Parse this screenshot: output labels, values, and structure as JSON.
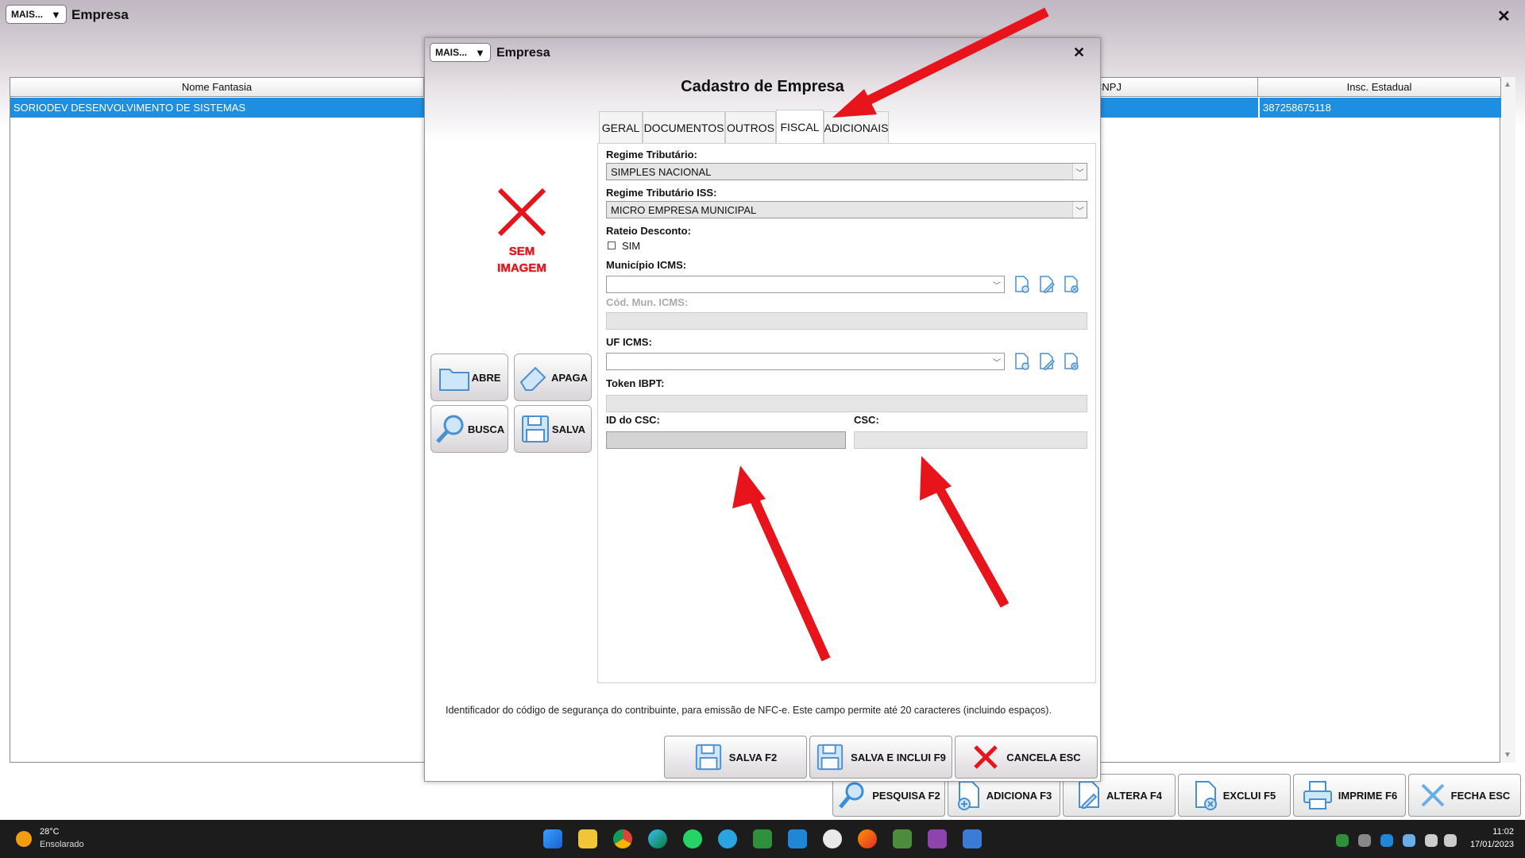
{
  "main_window": {
    "more_label": "MAIS...",
    "title": "Empresa",
    "columns": [
      "Nome Fantasia",
      "CNPJ",
      "Insc. Estadual"
    ],
    "selected_row": {
      "nome_fantasia": "SORIODEV DESENVOLVIMENTO DE SISTEMAS",
      "cnpj": "",
      "insc_estadual": "387258675118"
    },
    "bottom_buttons": [
      "PESQUISA F2",
      "ADICIONA F3",
      "ALTERA F4",
      "EXCLUI F5",
      "IMPRIME F6",
      "FECHA ESC"
    ]
  },
  "modal": {
    "more_label": "MAIS...",
    "title": "Empresa",
    "form_title": "Cadastro de Empresa",
    "tabs": [
      "GERAL",
      "DOCUMENTOS",
      "OUTROS",
      "FISCAL",
      "ADICIONAIS"
    ],
    "active_tab": "FISCAL",
    "no_image_text": "SEM IMAGEM",
    "side_buttons": {
      "open": "ABRE",
      "erase": "APAGA",
      "search": "BUSCA",
      "save": "SALVA"
    },
    "fields": {
      "regime_tributario": {
        "label": "Regime Tributário:",
        "value": "SIMPLES NACIONAL"
      },
      "regime_tributario_iss": {
        "label": "Regime Tributário ISS:",
        "value": "MICRO EMPRESA MUNICIPAL"
      },
      "rateio_desconto": {
        "label": "Rateio Desconto:",
        "checkbox_label": "SIM",
        "checked": false
      },
      "municipio_icms": {
        "label": "Município ICMS:",
        "value": ""
      },
      "cod_mun_icms": {
        "label": "Cód. Mun. ICMS:",
        "value": ""
      },
      "uf_icms": {
        "label": "UF ICMS:",
        "value": ""
      },
      "token_ibpt": {
        "label": "Token IBPT:",
        "value": ""
      },
      "id_csc": {
        "label": "ID do CSC:",
        "value": ""
      },
      "csc": {
        "label": "CSC:",
        "value": ""
      }
    },
    "hint": "Identificador do código de segurança do contribuinte, para emissão de NFC-e. Este campo permite até 20 caracteres (incluindo espaços).",
    "footer_buttons": {
      "save": "SALVA F2",
      "save_new": "SALVA E INCLUI F9",
      "cancel": "CANCELA ESC"
    }
  },
  "taskbar": {
    "weather_temp": "28°C",
    "weather_desc": "Ensolarado",
    "time": "11:02",
    "date": "17/01/2023"
  },
  "colors": {
    "selection": "#1e8fe0",
    "arrow": "#e8141b",
    "taskbar": "#1c1c1c"
  }
}
